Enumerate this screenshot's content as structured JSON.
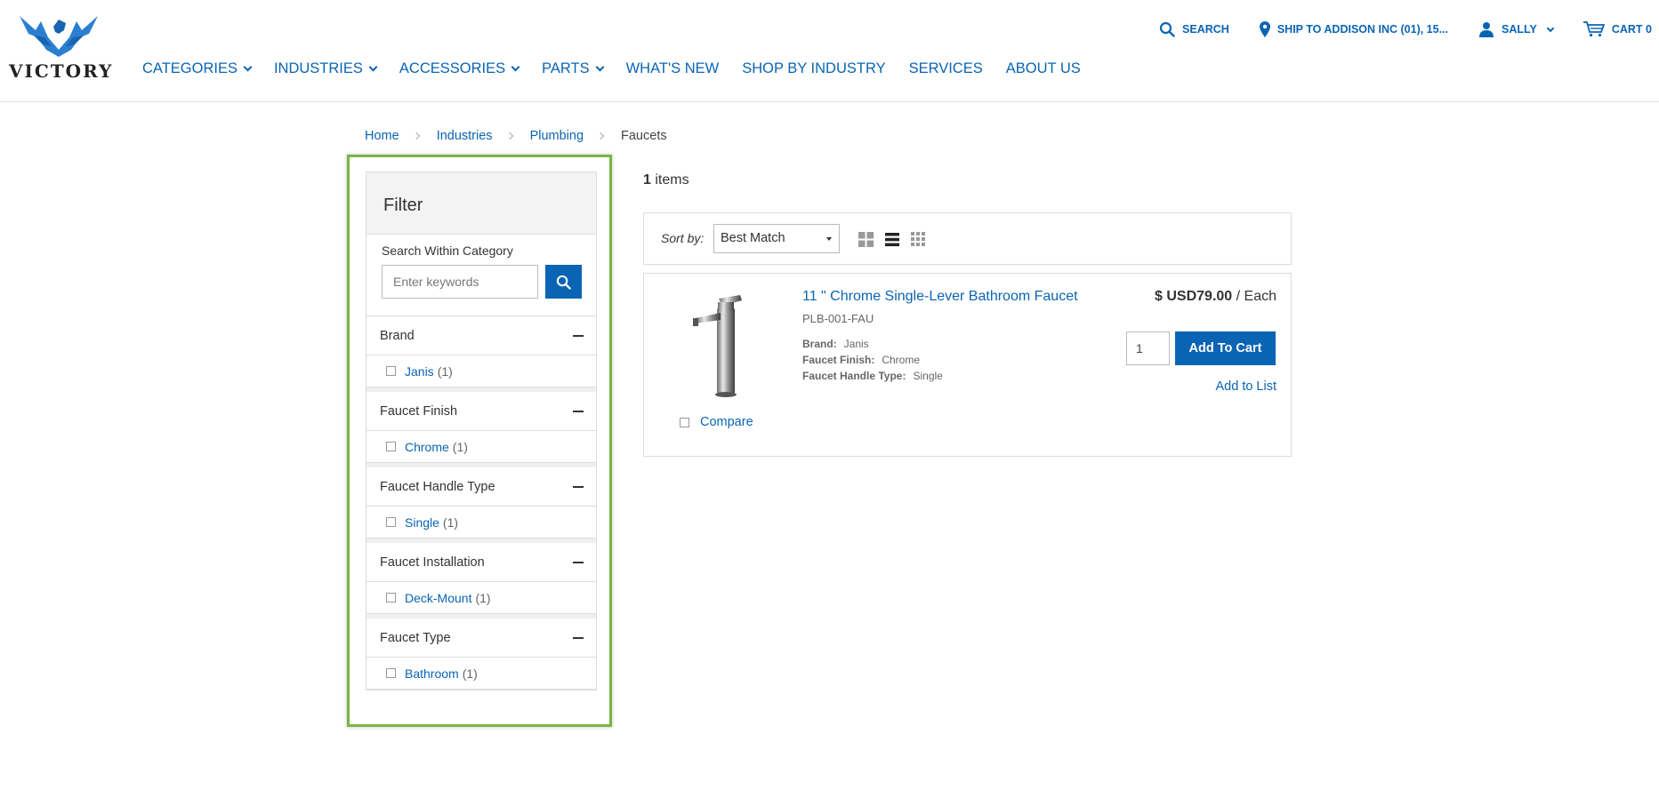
{
  "brand": {
    "logo_text": "VICTORY"
  },
  "main_nav": [
    {
      "label": "CATEGORIES",
      "has_dropdown": true
    },
    {
      "label": "INDUSTRIES",
      "has_dropdown": true
    },
    {
      "label": "ACCESSORIES",
      "has_dropdown": true
    },
    {
      "label": "PARTS",
      "has_dropdown": true
    },
    {
      "label": "WHAT'S NEW",
      "has_dropdown": false
    },
    {
      "label": "SHOP BY INDUSTRY",
      "has_dropdown": false
    },
    {
      "label": "SERVICES",
      "has_dropdown": false
    },
    {
      "label": "ABOUT US",
      "has_dropdown": false
    }
  ],
  "utility_nav": {
    "search": "SEARCH",
    "ship_to": "SHIP TO ADDISON INC (01), 15...",
    "user": "SALLY",
    "cart": "CART 0"
  },
  "breadcrumb": {
    "items": [
      "Home",
      "Industries",
      "Plumbing"
    ],
    "current": "Faucets"
  },
  "filter": {
    "title": "Filter",
    "search_label": "Search Within Category",
    "search_placeholder": "Enter keywords",
    "facets": [
      {
        "name": "Brand",
        "options": [
          {
            "label": "Janis",
            "count": "(1)"
          }
        ]
      },
      {
        "name": "Faucet Finish",
        "options": [
          {
            "label": "Chrome",
            "count": "(1)"
          }
        ]
      },
      {
        "name": "Faucet Handle Type",
        "options": [
          {
            "label": "Single",
            "count": "(1)"
          }
        ]
      },
      {
        "name": "Faucet Installation",
        "options": [
          {
            "label": "Deck-Mount",
            "count": "(1)"
          }
        ]
      },
      {
        "name": "Faucet Type",
        "options": [
          {
            "label": "Bathroom",
            "count": "(1)"
          }
        ]
      }
    ]
  },
  "results": {
    "count": "1",
    "count_suffix": " items",
    "sort_label": "Sort by:",
    "sort_value": "Best Match"
  },
  "product": {
    "title": "11 \" Chrome Single-Lever Bathroom Faucet",
    "sku": "PLB-001-FAU",
    "attributes": [
      {
        "key": "Brand:",
        "value": "Janis"
      },
      {
        "key": "Faucet Finish:",
        "value": "Chrome"
      },
      {
        "key": "Faucet Handle Type:",
        "value": "Single"
      }
    ],
    "price": "$ USD79.00",
    "price_unit": " / Each",
    "quantity": "1",
    "add_to_cart": "Add To Cart",
    "add_to_list": "Add to List",
    "compare": "Compare"
  },
  "colors": {
    "accent": "#0a64b4",
    "highlight_frame": "#7ab540"
  },
  "icons": [
    "search-icon",
    "location-pin-icon",
    "user-icon",
    "cart-icon",
    "grid-view-icon",
    "list-view-icon",
    "tile-view-icon",
    "minus-icon",
    "chevron-down-icon"
  ]
}
